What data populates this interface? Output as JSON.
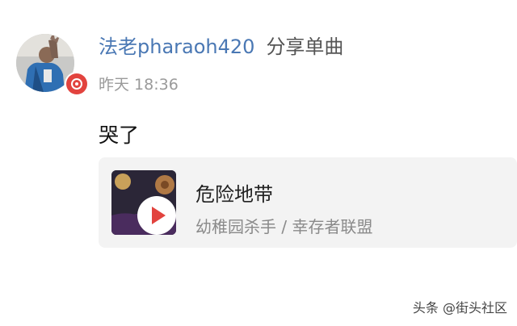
{
  "post": {
    "username": "法老pharaoh420",
    "action": "分享单曲",
    "time": "昨天 18:36",
    "comment": "哭了"
  },
  "music_card": {
    "title": "危险地带",
    "artist": "幼稚园杀手 / 幸存者联盟"
  },
  "watermark": "头条 @街头社区",
  "colors": {
    "username": "#4a78b4",
    "badge": "#e2433e",
    "play_icon": "#e2433e",
    "card_background": "#f3f3f3"
  },
  "icons": {
    "avatar": "user-avatar-photo",
    "badge": "music-badge-icon",
    "play": "play-icon"
  }
}
